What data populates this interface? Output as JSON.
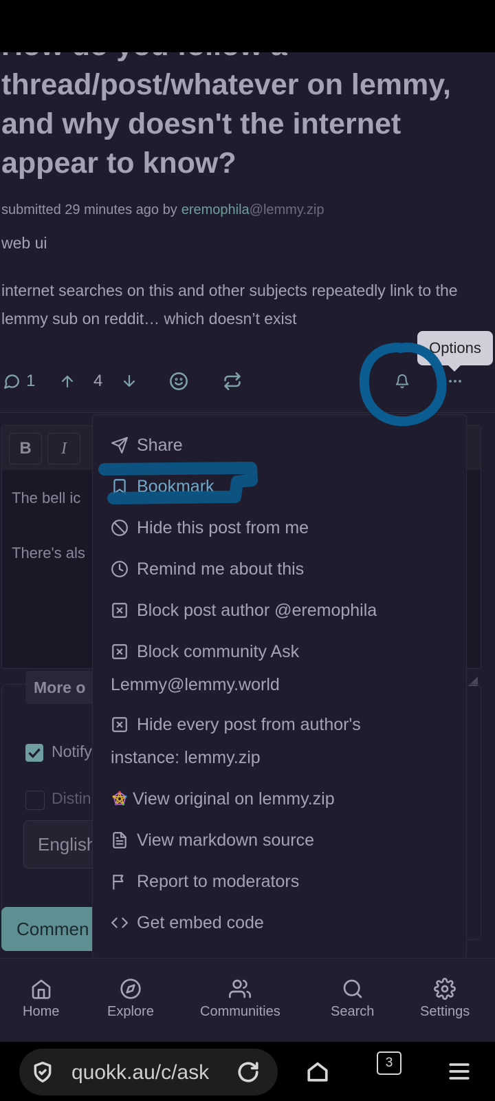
{
  "post": {
    "title": "How do you follow a thread/post/whatever on lemmy, and why doesn't the internet appear to know?",
    "meta_prefix": "submitted 29 minutes ago by",
    "author": "eremophila",
    "author_instance": "@lemmy.zip",
    "flair": "web ui",
    "body": "internet searches on this and other subjects repeatedly link to the lemmy sub on reddit… which doesn’t exist"
  },
  "actions": {
    "comments": "1",
    "score": "4"
  },
  "tooltip": "Options",
  "editor": {
    "bold": "B",
    "italic": "I",
    "line1": "The bell ic",
    "line2": "There's als"
  },
  "more_options": {
    "label": "More o",
    "notify_label": "Notify",
    "distinguish_label": "Distin",
    "notify_checked": true,
    "language": "English",
    "comment_button": "Commen"
  },
  "menu": {
    "items": [
      {
        "label": "Share",
        "icon": "send-icon"
      },
      {
        "label": "Bookmark",
        "icon": "bookmark-icon"
      },
      {
        "label": "Hide this post from me",
        "icon": "ban-icon"
      },
      {
        "label": "Remind me about this",
        "icon": "clock-icon"
      },
      {
        "label": "Block post author @eremophila",
        "icon": "x-square-icon"
      },
      {
        "label": "Block community Ask",
        "label2": "Lemmy@lemmy.world",
        "icon": "x-square-icon"
      },
      {
        "label": "Hide every post from author's",
        "label2": "instance: lemmy.zip",
        "icon": "x-square-icon"
      },
      {
        "label": "View original on lemmy.zip",
        "icon": "fediverse-icon"
      },
      {
        "label": "View markdown source",
        "icon": "file-text-icon"
      },
      {
        "label": "Report to moderators",
        "icon": "flag-icon"
      },
      {
        "label": "Get embed code",
        "icon": "code-icon"
      }
    ]
  },
  "nav": {
    "items": [
      {
        "label": "Home",
        "icon": "home-icon"
      },
      {
        "label": "Explore",
        "icon": "compass-icon"
      },
      {
        "label": "Communities",
        "icon": "users-icon"
      },
      {
        "label": "Search",
        "icon": "search-icon"
      },
      {
        "label": "Settings",
        "icon": "gear-icon"
      }
    ]
  },
  "browser": {
    "url": "quokk.au/c/ask",
    "tab_count": "3"
  },
  "colors": {
    "background": "#1f1c2e",
    "accent": "#6e9ea2",
    "highlight": "#6fa8c9",
    "annotation": "#0b5d91"
  }
}
